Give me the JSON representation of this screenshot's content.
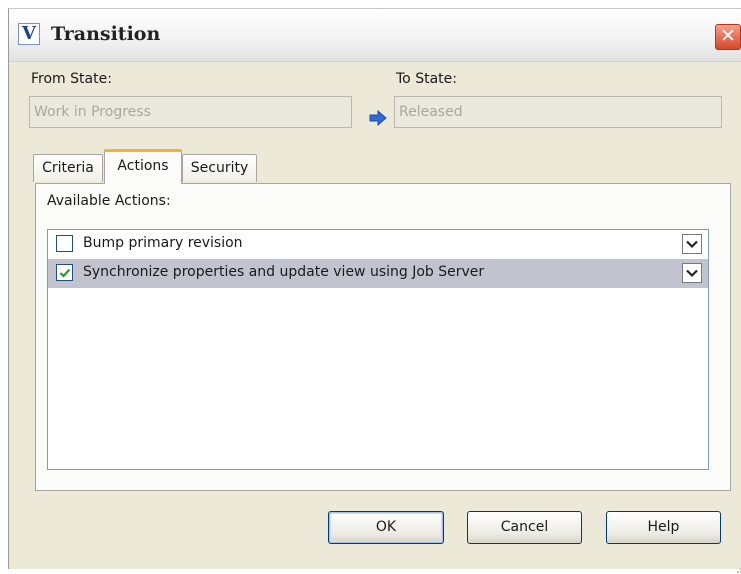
{
  "window": {
    "title": "Transition",
    "app_icon_glyph": "V",
    "close_glyph": "✕"
  },
  "from_state": {
    "label": "From State:",
    "value": "Work in Progress"
  },
  "to_state": {
    "label": "To State:",
    "value": "Released"
  },
  "arrow_icon": "right-arrow-icon",
  "tabs": [
    {
      "label": "Criteria",
      "active": false
    },
    {
      "label": "Actions",
      "active": true
    },
    {
      "label": "Security",
      "active": false
    }
  ],
  "actions_panel": {
    "heading": "Available Actions:",
    "items": [
      {
        "label": "Bump primary revision",
        "checked": false,
        "selected": false
      },
      {
        "label": "Synchronize properties and update view using Job Server",
        "checked": true,
        "selected": true
      }
    ]
  },
  "buttons": {
    "ok": "OK",
    "cancel": "Cancel",
    "help": "Help"
  },
  "colors": {
    "dialog_bg": "#ece9d8",
    "selected_row": "#c3c3d0",
    "active_tab_accent": "#f2b33d",
    "close_button": "#d4482a",
    "arrow": "#2d6bd6",
    "checkmark": "#21a121"
  }
}
